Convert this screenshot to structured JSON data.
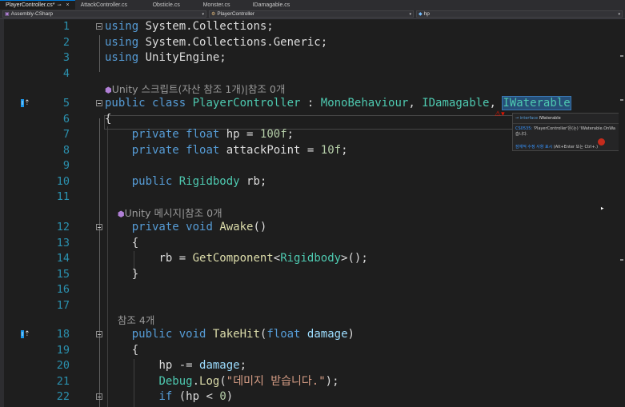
{
  "tabs": [
    {
      "label": "PlayerController.cs*",
      "active": true
    },
    {
      "label": "AttackController.cs"
    },
    {
      "label": "Obsticle.cs"
    },
    {
      "label": "Monster.cs"
    },
    {
      "label": "IDamagable.cs"
    }
  ],
  "navbar": {
    "project": "Assembly-CSharp",
    "class": "PlayerController",
    "member": "hp"
  },
  "codelens": {
    "line5": "Unity 스크립트(자산 참조 1개)|참조 0개",
    "line12": "Unity 메시지|참조 0개",
    "line18": "참조 4개"
  },
  "lines": {
    "l1": {
      "n": "1",
      "kw": "using",
      "ns": " System.Collections;"
    },
    "l2": {
      "n": "2",
      "kw": "using",
      "ns": " System.Collections.Generic;"
    },
    "l3": {
      "n": "3",
      "kw": "using",
      "ns": " UnityEngine;"
    },
    "l4": {
      "n": "4"
    },
    "l5": {
      "n": "5",
      "public": "public",
      "class": "class",
      "name": "PlayerController",
      "colon": " : ",
      "base1": "MonoBehaviour",
      "comma1": ", ",
      "base2": "IDamagable",
      "comma2": ", ",
      "base3": "IWaterable"
    },
    "l6": {
      "n": "6",
      "text": "{"
    },
    "l7": {
      "n": "7",
      "mod": "private",
      "type": "float",
      "rest": " hp = ",
      "num": "100f",
      "end": ";"
    },
    "l8": {
      "n": "8",
      "mod": "private",
      "type": "float",
      "rest": " attackPoint = ",
      "num": "10f",
      "end": ";"
    },
    "l9": {
      "n": "9"
    },
    "l10": {
      "n": "10",
      "mod": "public",
      "type": "Rigidbody",
      "rest": " rb;"
    },
    "l11": {
      "n": "11"
    },
    "l12": {
      "n": "12",
      "mod": "private",
      "type": "void",
      "fn": "Awake",
      "rest": "()"
    },
    "l13": {
      "n": "13",
      "text": "{"
    },
    "l14": {
      "n": "14",
      "a": "rb = ",
      "fn": "GetComponent",
      "lt": "<",
      "ty": "Rigidbody",
      "rest": ">();"
    },
    "l15": {
      "n": "15",
      "text": "}"
    },
    "l16": {
      "n": "16"
    },
    "l17": {
      "n": "17"
    },
    "l18": {
      "n": "18",
      "mod": "public",
      "type": "void",
      "fn": "TakeHit",
      "p1": "(",
      "ptype": "float",
      "pname": " damage",
      "p2": ")"
    },
    "l19": {
      "n": "19",
      "text": "{"
    },
    "l20": {
      "n": "20",
      "a": "hp -= ",
      "var": "damage",
      "end": ";"
    },
    "l21": {
      "n": "21",
      "ty": "Debug",
      "dot": ".",
      "fn": "Log",
      "p1": "(",
      "str": "\"데미지 받습니다.\"",
      "p2": ");"
    },
    "l22": {
      "n": "22",
      "kw": "if",
      "rest": " (hp < ",
      "num": "0",
      "end": ")"
    }
  },
  "tooltip": {
    "kind": "interface",
    "name": "IWaterable",
    "code": "CS0535:",
    "msg": "'PlayerController'은(는) 'IWaterable.OnWa",
    "msg2": "습니다.",
    "fix": "잠재적 수정 사항 표시",
    "shortcut": "(Alt+Enter 또는 Ctrl+.)"
  },
  "colors": {
    "keyword": "#569cd6",
    "type": "#4ec9b0",
    "method": "#dcdcaa",
    "number": "#b5cea8",
    "string": "#d69d85",
    "lineNumber": "#2b91af"
  }
}
